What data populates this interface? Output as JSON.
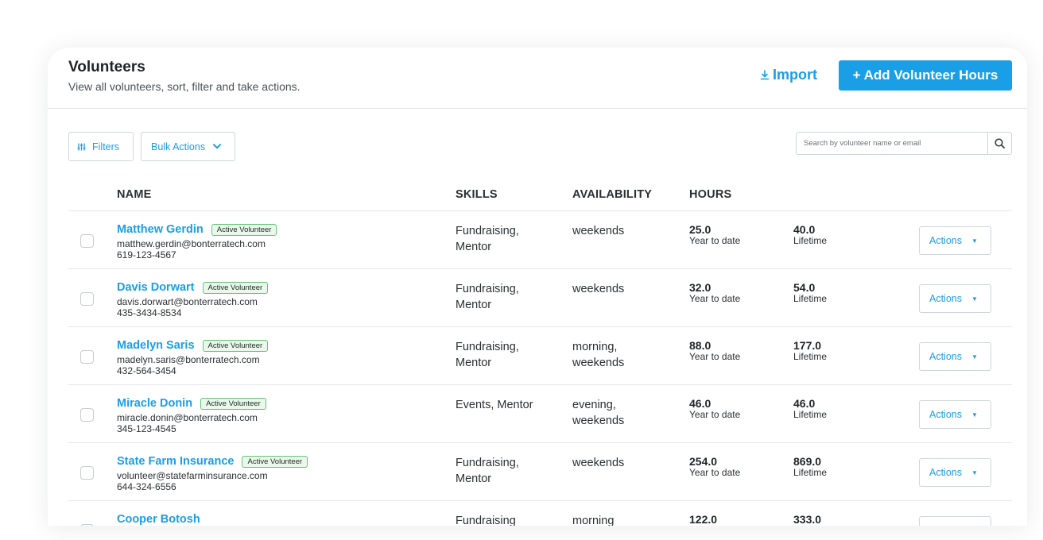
{
  "header": {
    "title": "Volunteers",
    "subtitle": "View all volunteers, sort, filter and take actions.",
    "import_label": "Import",
    "import_icon": "download-icon",
    "add_label": "+ Add Volunteer Hours"
  },
  "toolbar": {
    "filters_label": "Filters",
    "filters_icon": "sliders-icon",
    "bulk_actions_label": "Bulk Actions",
    "search_placeholder": "Search by volunteer name or email",
    "search_icon": "search-icon"
  },
  "table": {
    "columns": [
      "NAME",
      "SKILLS",
      "AVAILABILITY",
      "HOURS"
    ],
    "ytd_label": "Year to date",
    "lifetime_label": "Lifetime",
    "actions_label": "Actions",
    "rows": [
      {
        "name": "Matthew Gerdin",
        "status": "Active Volunteer",
        "email": "matthew.gerdin@bonterratech.com",
        "phone": "619-123-4567",
        "skills": "Fundraising, Mentor",
        "availability": "weekends",
        "ytd": "25.0",
        "lifetime": "40.0"
      },
      {
        "name": "Davis Dorwart",
        "status": "Active Volunteer",
        "email": "davis.dorwart@bonterratech.com",
        "phone": "435-3434-8534",
        "skills": "Fundraising, Mentor",
        "availability": "weekends",
        "ytd": "32.0",
        "lifetime": "54.0"
      },
      {
        "name": "Madelyn Saris",
        "status": "Active Volunteer",
        "email": "madelyn.saris@bonterratech.com",
        "phone": "432-564-3454",
        "skills": "Fundraising, Mentor",
        "availability": "morning, weekends",
        "ytd": "88.0",
        "lifetime": "177.0"
      },
      {
        "name": "Miracle Donin",
        "status": "Active Volunteer",
        "email": "miracle.donin@bonterratech.com",
        "phone": "345-123-4545",
        "skills": "Events, Mentor",
        "availability": "evening, weekends",
        "ytd": "46.0",
        "lifetime": "46.0"
      },
      {
        "name": "State Farm Insurance",
        "status": "Active Volunteer",
        "email": "volunteer@statefarminsurance.com",
        "phone": "644-324-6556",
        "skills": "Fundraising, Mentor",
        "availability": "weekends",
        "ytd": "254.0",
        "lifetime": "869.0"
      },
      {
        "name": "Cooper Botosh",
        "status": "",
        "email": "",
        "phone": "",
        "skills": "Fundraising",
        "availability": "morning",
        "ytd": "122.0",
        "lifetime": "333.0"
      }
    ]
  },
  "colors": {
    "accent": "#1a9ee6",
    "badge_border": "#66c27a",
    "badge_bg": "#eaf8ec",
    "divider": "#e3e6ea"
  }
}
